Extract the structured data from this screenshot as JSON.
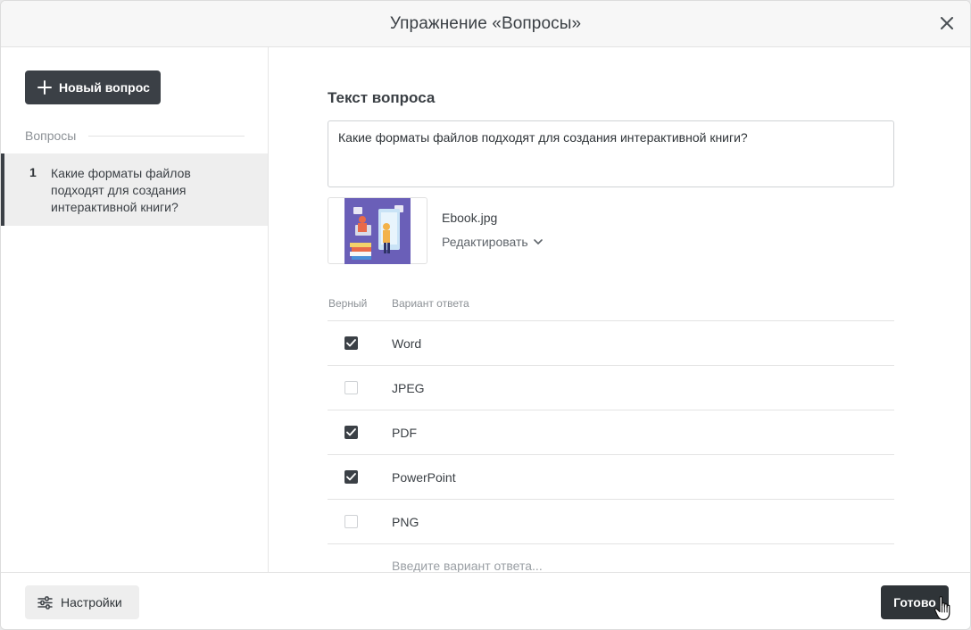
{
  "header": {
    "title": "Упражнение «Вопросы»"
  },
  "sidebar": {
    "new_question_label": "Новый вопрос",
    "section_label": "Вопросы",
    "questions": [
      {
        "number": "1",
        "text": "Какие форматы файлов подходят для создания интерактивной книги?"
      }
    ]
  },
  "main": {
    "heading": "Текст вопроса",
    "question_text": "Какие форматы файлов подходят для создания интерактивной книги?",
    "image": {
      "file_name": "Ebook.jpg",
      "edit_label": "Редактировать"
    },
    "columns": {
      "correct": "Верный",
      "answer": "Вариант ответа"
    },
    "answers": [
      {
        "text": "Word",
        "correct": true
      },
      {
        "text": "JPEG",
        "correct": false
      },
      {
        "text": "PDF",
        "correct": true
      },
      {
        "text": "PowerPoint",
        "correct": true
      },
      {
        "text": "PNG",
        "correct": false
      }
    ],
    "new_answer_placeholder": "Введите вариант ответа..."
  },
  "footer": {
    "settings_label": "Настройки",
    "done_label": "Готово"
  },
  "colors": {
    "primary": "#3b4046",
    "border": "#e3e3e3",
    "muted": "#8c9196",
    "illustration_bg": "#6a5fb8"
  }
}
